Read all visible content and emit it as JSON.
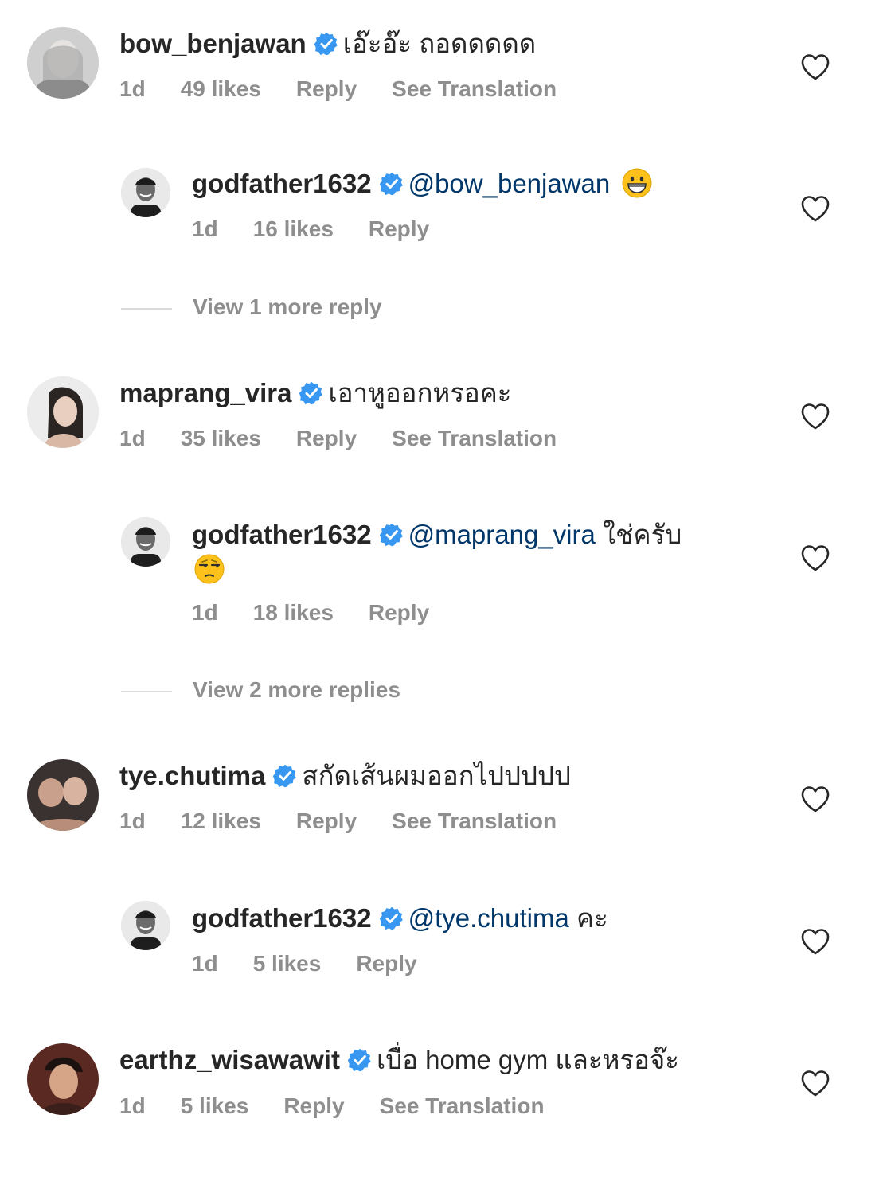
{
  "colors": {
    "verified": "#3897f0",
    "mention": "#00376b",
    "meta": "#8e8e8e",
    "text": "#262626"
  },
  "icons": {
    "verified": "verified-badge-icon",
    "like": "heart-outline-icon"
  },
  "comments": [
    {
      "username": "bow_benjawan",
      "mention": "",
      "text": "เอ๊ะอ๊ะ ถอดดดดด",
      "emoji": "",
      "time": "1d",
      "likes": "49 likes",
      "reply": "Reply",
      "translate": "See Translation"
    },
    {
      "username": "godfather1632",
      "mention": "@bow_benjawan",
      "text": "",
      "emoji": "grinning-face-emoji",
      "time": "1d",
      "likes": "16 likes",
      "reply": "Reply",
      "translate": ""
    },
    {
      "username": "maprang_vira",
      "mention": "",
      "text": "เอาหูออกหรอคะ",
      "emoji": "",
      "time": "1d",
      "likes": "35 likes",
      "reply": "Reply",
      "translate": "See Translation"
    },
    {
      "username": "godfather1632",
      "mention": "@maprang_vira",
      "text": "ใช่ครับ",
      "emoji": "unamused-face-emoji",
      "time": "1d",
      "likes": "18 likes",
      "reply": "Reply",
      "translate": ""
    },
    {
      "username": "tye.chutima",
      "mention": "",
      "text": "สกัดเส้นผมออกไปปปปป",
      "emoji": "",
      "time": "1d",
      "likes": "12 likes",
      "reply": "Reply",
      "translate": "See Translation"
    },
    {
      "username": "godfather1632",
      "mention": "@tye.chutima",
      "text": "คะ",
      "emoji": "",
      "time": "1d",
      "likes": "5 likes",
      "reply": "Reply",
      "translate": ""
    },
    {
      "username": "earthz_wisawawit",
      "mention": "",
      "text": "เบื่อ home gym และหรอจ๊ะ",
      "emoji": "",
      "time": "1d",
      "likes": "5 likes",
      "reply": "Reply",
      "translate": "See Translation"
    }
  ],
  "view_more": [
    "View 1 more reply",
    "View 2 more replies"
  ]
}
